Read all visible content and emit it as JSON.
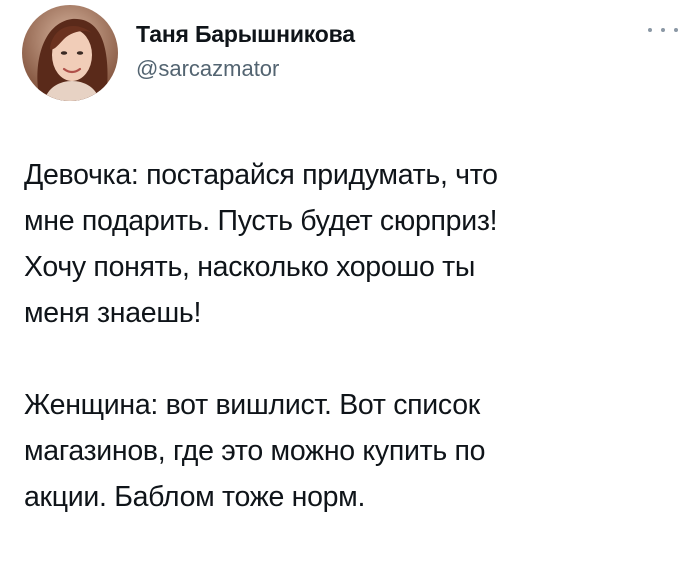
{
  "tweet": {
    "author": {
      "display_name": "Таня Барышникова",
      "handle": "@sarcazmator",
      "avatar_icon": "user-avatar-photo"
    },
    "more_icon": "more-horizontal-icon",
    "paragraphs": [
      "Девочка: постарайся придумать, что\nмне подарить. Пусть будет сюрприз!\nХочу понять, насколько хорошо ты\nменя знаешь!",
      "Женщина: вот вишлист. Вот список\nмагазинов, где это можно купить по\nакции.  Баблом тоже норм."
    ]
  },
  "colors": {
    "text_primary": "#0f1419",
    "text_secondary": "#536471",
    "background": "#ffffff"
  }
}
